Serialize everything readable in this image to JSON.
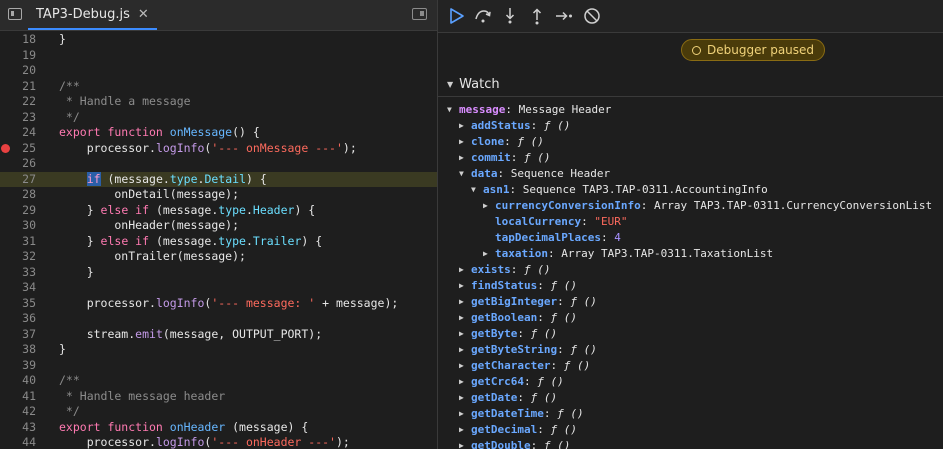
{
  "editor": {
    "tab_name": "TAP3-Debug.js",
    "tab_close": "✕",
    "lines": [
      {
        "n": "18",
        "html": "}"
      },
      {
        "n": "19",
        "html": ""
      },
      {
        "n": "20",
        "html": ""
      },
      {
        "n": "21",
        "html": "<span class='cm'>/**</span>"
      },
      {
        "n": "22",
        "html": "<span class='cm'> * Handle a message</span>"
      },
      {
        "n": "23",
        "html": "<span class='cm'> */</span>"
      },
      {
        "n": "24",
        "html": "<span class='kw'>export function</span> <span class='fn'>onMessage</span>() {"
      },
      {
        "n": "25",
        "html": "    processor.<span class='mem'>logInfo</span>(<span class='str'>'--- onMessage ---'</span>);",
        "bp": true
      },
      {
        "n": "26",
        "html": ""
      },
      {
        "n": "27",
        "html": "    <span class='sel'>if</span> (message.<span class='prop'>type</span>.<span class='prop'>Detail</span>) {",
        "hl": true
      },
      {
        "n": "28",
        "html": "        onDetail(message);"
      },
      {
        "n": "29",
        "html": "    } <span class='kw'>else if</span> (message.<span class='prop'>type</span>.<span class='prop'>Header</span>) {"
      },
      {
        "n": "30",
        "html": "        onHeader(message);"
      },
      {
        "n": "31",
        "html": "    } <span class='kw'>else if</span> (message.<span class='prop'>type</span>.<span class='prop'>Trailer</span>) {"
      },
      {
        "n": "32",
        "html": "        onTrailer(message);"
      },
      {
        "n": "33",
        "html": "    }"
      },
      {
        "n": "34",
        "html": ""
      },
      {
        "n": "35",
        "html": "    processor.<span class='mem'>logInfo</span>(<span class='str'>'--- message: '</span> + message);"
      },
      {
        "n": "36",
        "html": ""
      },
      {
        "n": "37",
        "html": "    stream.<span class='mem'>emit</span>(message, OUTPUT_PORT);"
      },
      {
        "n": "38",
        "html": "}"
      },
      {
        "n": "39",
        "html": ""
      },
      {
        "n": "40",
        "html": "<span class='cm'>/**</span>"
      },
      {
        "n": "41",
        "html": "<span class='cm'> * Handle message header</span>"
      },
      {
        "n": "42",
        "html": "<span class='cm'> */</span>"
      },
      {
        "n": "43",
        "html": "<span class='kw'>export function</span> <span class='fn'>onHeader</span> (message) {"
      },
      {
        "n": "44",
        "html": "    processor.<span class='mem'>logInfo</span>(<span class='str'>'--- onHeader ---'</span>);"
      }
    ]
  },
  "debugger": {
    "paused_label": "Debugger paused",
    "watch_title": "Watch",
    "tree": [
      {
        "depth": 0,
        "exp": "open",
        "key": "message",
        "root": true,
        "val": "Message Header",
        "vt": "val"
      },
      {
        "depth": 1,
        "exp": "closed",
        "key": "addStatus",
        "val": "ƒ ()",
        "vt": "fval"
      },
      {
        "depth": 1,
        "exp": "closed",
        "key": "clone",
        "val": "ƒ ()",
        "vt": "fval"
      },
      {
        "depth": 1,
        "exp": "closed",
        "key": "commit",
        "val": "ƒ ()",
        "vt": "fval"
      },
      {
        "depth": 1,
        "exp": "open",
        "key": "data",
        "val": "Sequence Header",
        "vt": "val"
      },
      {
        "depth": 2,
        "exp": "open",
        "key": "asn1",
        "val": "Sequence TAP3.TAP-0311.AccountingInfo",
        "vt": "val"
      },
      {
        "depth": 3,
        "exp": "closed",
        "key": "currencyConversionInfo",
        "val": "Array TAP3.TAP-0311.CurrencyConversionList",
        "vt": "val"
      },
      {
        "depth": 3,
        "exp": "none",
        "key": "localCurrency",
        "val": "\"EUR\"",
        "vt": "sval"
      },
      {
        "depth": 3,
        "exp": "none",
        "key": "tapDecimalPlaces",
        "val": "4",
        "vt": "nval"
      },
      {
        "depth": 3,
        "exp": "closed",
        "key": "taxation",
        "val": "Array TAP3.TAP-0311.TaxationList",
        "vt": "val"
      },
      {
        "depth": 1,
        "exp": "closed",
        "key": "exists",
        "val": "ƒ ()",
        "vt": "fval"
      },
      {
        "depth": 1,
        "exp": "closed",
        "key": "findStatus",
        "val": "ƒ ()",
        "vt": "fval"
      },
      {
        "depth": 1,
        "exp": "closed",
        "key": "getBigInteger",
        "val": "ƒ ()",
        "vt": "fval"
      },
      {
        "depth": 1,
        "exp": "closed",
        "key": "getBoolean",
        "val": "ƒ ()",
        "vt": "fval"
      },
      {
        "depth": 1,
        "exp": "closed",
        "key": "getByte",
        "val": "ƒ ()",
        "vt": "fval"
      },
      {
        "depth": 1,
        "exp": "closed",
        "key": "getByteString",
        "val": "ƒ ()",
        "vt": "fval"
      },
      {
        "depth": 1,
        "exp": "closed",
        "key": "getCharacter",
        "val": "ƒ ()",
        "vt": "fval"
      },
      {
        "depth": 1,
        "exp": "closed",
        "key": "getCrc64",
        "val": "ƒ ()",
        "vt": "fval"
      },
      {
        "depth": 1,
        "exp": "closed",
        "key": "getDate",
        "val": "ƒ ()",
        "vt": "fval"
      },
      {
        "depth": 1,
        "exp": "closed",
        "key": "getDateTime",
        "val": "ƒ ()",
        "vt": "fval"
      },
      {
        "depth": 1,
        "exp": "closed",
        "key": "getDecimal",
        "val": "ƒ ()",
        "vt": "fval"
      },
      {
        "depth": 1,
        "exp": "closed",
        "key": "getDouble",
        "val": "ƒ ()",
        "vt": "fval"
      }
    ]
  },
  "colors": {
    "accent": "#3c8cff",
    "breakpoint": "#e84141",
    "paused_badge": "#4a3b0a"
  }
}
